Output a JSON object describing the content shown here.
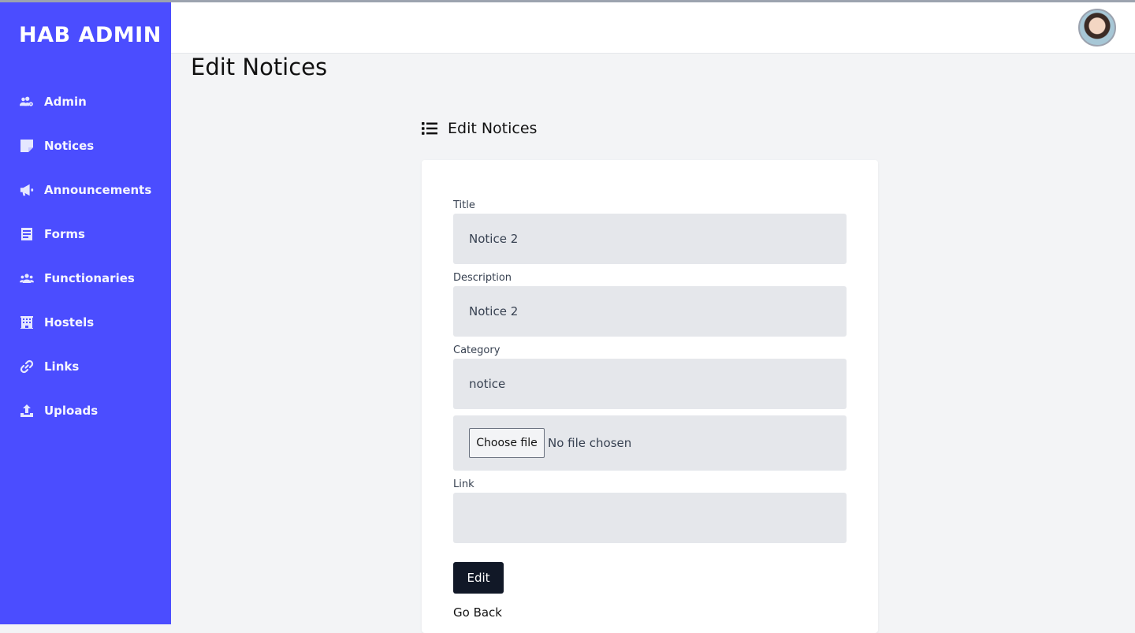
{
  "app": {
    "brand": "HAB ADMIN"
  },
  "sidebar": {
    "items": [
      {
        "label": "Admin",
        "icon": "users-cog-icon"
      },
      {
        "label": "Notices",
        "icon": "sticky-note-icon"
      },
      {
        "label": "Announcements",
        "icon": "megaphone-icon"
      },
      {
        "label": "Forms",
        "icon": "form-icon"
      },
      {
        "label": "Functionaries",
        "icon": "users-icon"
      },
      {
        "label": "Hostels",
        "icon": "building-icon"
      },
      {
        "label": "Links",
        "icon": "link-icon"
      },
      {
        "label": "Uploads",
        "icon": "upload-icon"
      }
    ]
  },
  "header": {
    "avatar": "user-avatar"
  },
  "page": {
    "title": "Edit Notices",
    "section_title": "Edit Notices"
  },
  "form": {
    "title_label": "Title",
    "title_value": "Notice 2",
    "description_label": "Description",
    "description_value": "Notice 2",
    "category_label": "Category",
    "category_value": "notice",
    "file_button": "Choose file",
    "file_status": "No file chosen",
    "link_label": "Link",
    "link_value": "",
    "submit_label": "Edit",
    "back_label": "Go Back"
  },
  "colors": {
    "sidebar_bg": "#4b4dff",
    "page_bg": "#f3f4f6",
    "input_bg": "#e5e7eb",
    "button_bg": "#111827"
  }
}
